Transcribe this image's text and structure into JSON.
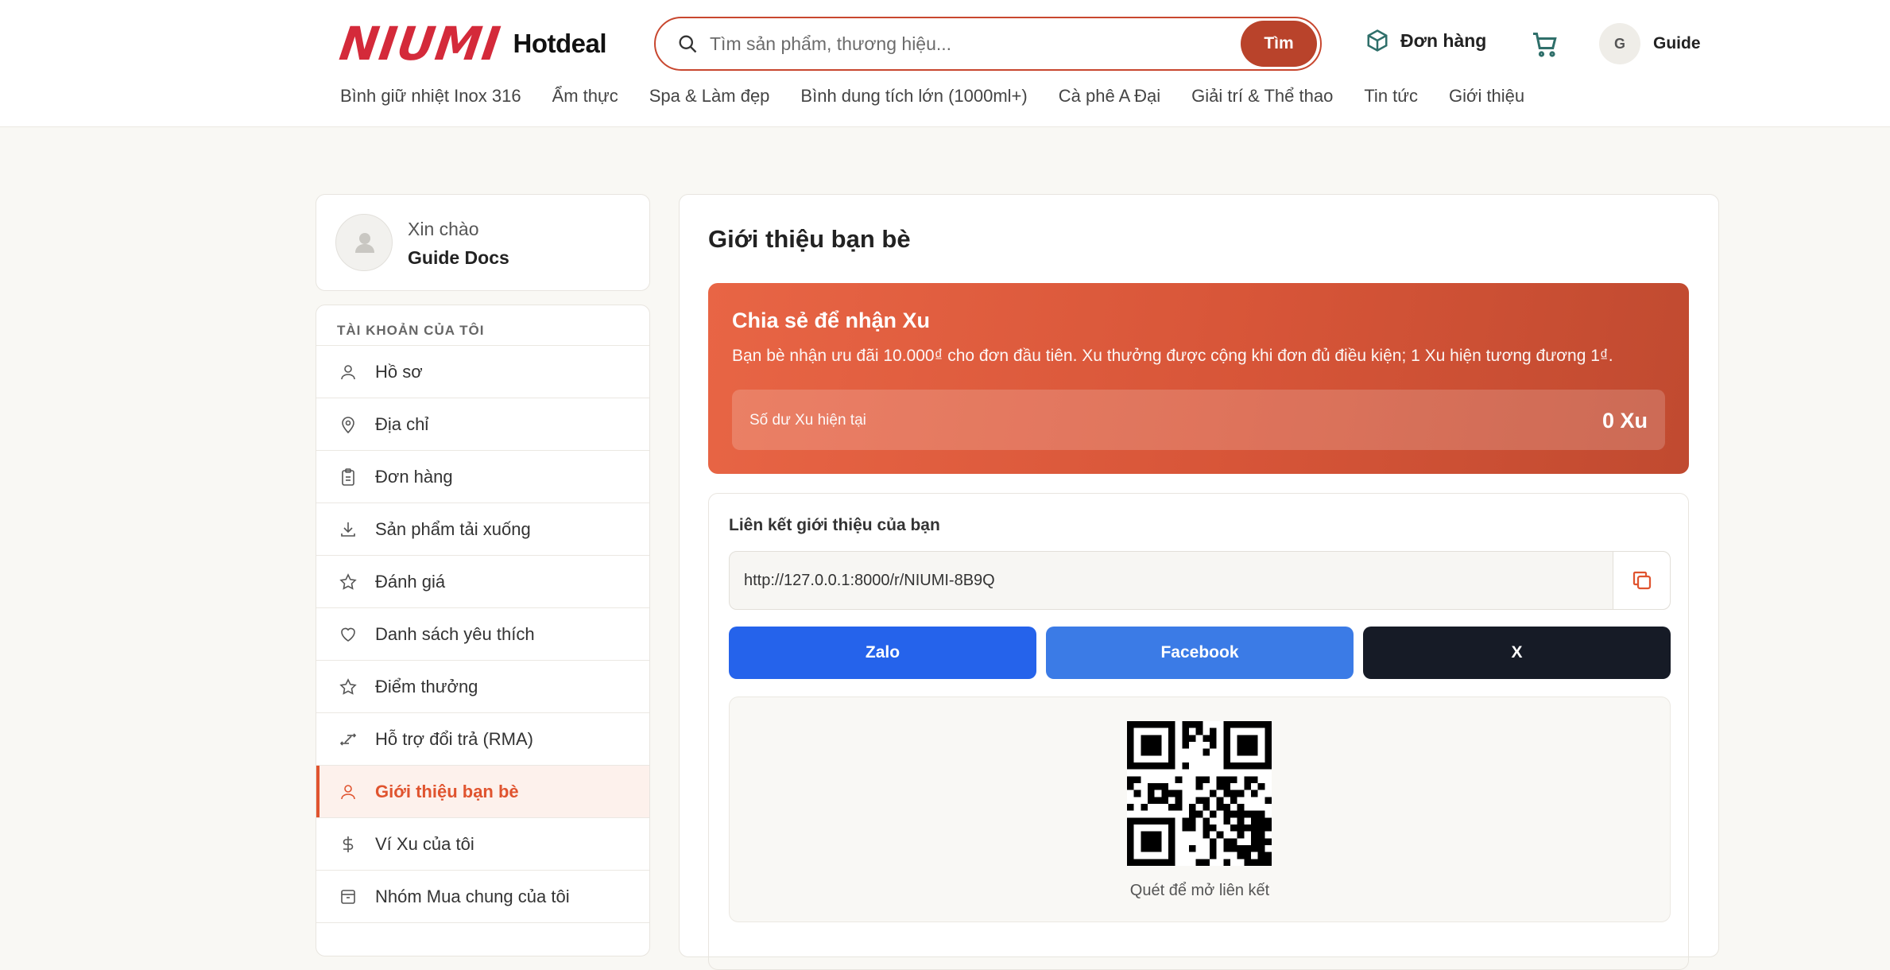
{
  "header": {
    "logo_mark": "NIUMI",
    "logo_text": "Hotdeal",
    "search_placeholder": "Tìm sản phẩm, thương hiệu...",
    "search_button": "Tìm",
    "orders_label": "Đơn hàng",
    "user_initial": "G",
    "user_name": "Guide",
    "nav": [
      "Bình giữ nhiệt Inox 316",
      "Ẩm thực",
      "Spa & Làm đẹp",
      "Bình dung tích lớn (1000ml+)",
      "Cà phê A Đại",
      "Giải trí & Thể thao",
      "Tin tức",
      "Giới thiệu"
    ]
  },
  "sidebar": {
    "greeting": "Xin chào",
    "name": "Guide Docs",
    "section_title": "TÀI KHOẢN CỦA TÔI",
    "items": [
      {
        "label": "Hồ sơ",
        "icon": "user-icon"
      },
      {
        "label": "Địa chỉ",
        "icon": "map-pin-icon"
      },
      {
        "label": "Đơn hàng",
        "icon": "clipboard-icon"
      },
      {
        "label": "Sản phẩm tải xuống",
        "icon": "download-icon"
      },
      {
        "label": "Đánh giá",
        "icon": "star-icon"
      },
      {
        "label": "Danh sách yêu thích",
        "icon": "heart-icon"
      },
      {
        "label": "Điểm thưởng",
        "icon": "star-icon"
      },
      {
        "label": "Hỗ trợ đổi trả (RMA)",
        "icon": "swap-icon"
      },
      {
        "label": "Giới thiệu bạn bè",
        "icon": "user-icon",
        "active": true
      },
      {
        "label": "Ví Xu của tôi",
        "icon": "dollar-icon"
      },
      {
        "label": "Nhóm Mua chung của tôi",
        "icon": "box-icon"
      }
    ]
  },
  "main": {
    "title": "Giới thiệu bạn bè",
    "promo": {
      "title": "Chia sẻ để nhận Xu",
      "description": "Bạn bè nhận ưu đãi 10.000₫ cho đơn đầu tiên. Xu thưởng được cộng khi đơn đủ điều kiện; 1 Xu hiện tương đương 1₫.",
      "balance_label": "Số dư Xu hiện tại",
      "balance_value": "0 Xu"
    },
    "referral": {
      "label": "Liên kết giới thiệu của bạn",
      "url": "http://127.0.0.1:8000/r/NIUMI-8B9Q",
      "share_buttons": [
        {
          "label": "Zalo",
          "color": "#2563eb"
        },
        {
          "label": "Facebook",
          "color": "#3b7be6"
        },
        {
          "label": "X",
          "color": "#161b26"
        }
      ],
      "qr_caption": "Quét để mở liên kết"
    }
  },
  "colors": {
    "accent": "#e0542f",
    "brand": "#d42a3a",
    "search_button": "#b9432b"
  }
}
